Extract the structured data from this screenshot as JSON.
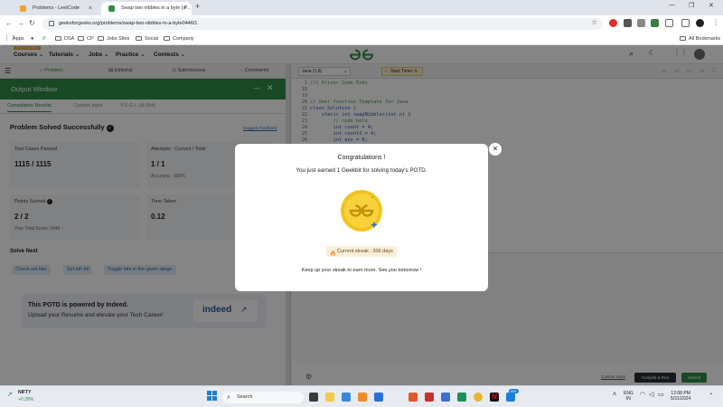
{
  "browser": {
    "tabs": [
      {
        "label": "Problems - LeetCode",
        "active": false
      },
      {
        "label": "Swap two nibbles in a byte | P...",
        "active": true
      }
    ],
    "url": "geeksforgeeks.org/problems/swap-two-nibbles-in-a-byte0446/1",
    "bookmarks": [
      "Apps",
      "DSA",
      "CP",
      "Jobs Sites",
      "Social",
      "Company"
    ],
    "all_bookmarks": "All Bookmarks"
  },
  "site": {
    "logo_alt": "GfG",
    "badge": "GFG ACADEMY",
    "nav": [
      "Courses",
      "Tutorials",
      "Jobs",
      "Practice",
      "Contests"
    ]
  },
  "problem_tabs": [
    "Problem",
    "Editorial",
    "Submissions",
    "Comments"
  ],
  "output": {
    "title": "Output Window",
    "tabs": [
      "Compilation Results",
      "Custom Input",
      "Y.O.G.I. (AI Bot)"
    ],
    "status": "Problem Solved Successfully",
    "suggest": "Suggest Feedback",
    "cards": {
      "test_cases": {
        "label": "Test Cases Passed",
        "value": "1115 / 1115"
      },
      "attempts": {
        "label": "Attempts : Correct / Total",
        "value": "1 / 1",
        "sub": "Accuracy : 100%"
      },
      "points": {
        "label": "Points Scored",
        "value": "2 / 2",
        "sub": "Your Total Score: 1446"
      },
      "time": {
        "label": "Time Taken",
        "value": "0.12"
      }
    },
    "solve_next": "Solve Next",
    "next_problems": [
      "Check set bits",
      "Set kth bit",
      "Toggle bits in the given range"
    ],
    "promo": {
      "title": "This POTD is powered by Indeed.",
      "subtitle": "Upload your Resume and elevate your Tech Career!",
      "brand": "indeed"
    }
  },
  "editor": {
    "language": "Java (1.8)",
    "timer_label": "Start Timer",
    "lines": [
      "1",
      "18",
      "19",
      "20",
      "21",
      "22",
      "23",
      "24",
      "25",
      "26"
    ],
    "code": [
      "//{ Driver Code Ends",
      "",
      "",
      "// User function Template for Java",
      "class Solution {",
      "    static int swapNibbles(int n) {",
      "        // code here",
      "        int count = 4;",
      "        int count2 = 4;",
      "        int ans = 0;"
    ],
    "custom_input": "Custom Input",
    "compile_run": "Compile & Run",
    "submit": "Submit"
  },
  "modal": {
    "title": "Congratulations !",
    "message": "You just earned 1 Geekbit for solving today's POTD.",
    "coin_logo": "GfG",
    "streak": "Current streak : 306 days",
    "footer": "Keep up your streak to earn more. See you tomorrow !"
  },
  "taskbar": {
    "stock_name": "NIFTY",
    "stock_change": "+0.28%",
    "search": "Search",
    "lang": "ENG",
    "region": "IN",
    "time": "12:08 PM",
    "date": "5/31/2024",
    "notif_count": "99+"
  },
  "colors": {
    "gfg_green": "#2f8d46",
    "coin_gold": "#f3c623"
  }
}
